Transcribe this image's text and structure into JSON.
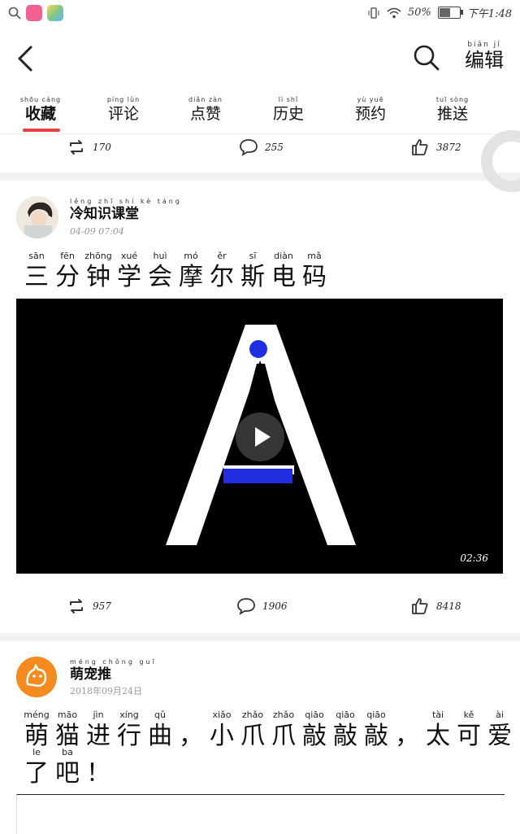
{
  "status_bar": {
    "battery": "50%",
    "time": "下午1:48",
    "icons": [
      "search-icon",
      "app-icon-pink",
      "app-icon-colorful",
      "vibrate-icon",
      "wifi-icon",
      "battery-icon"
    ]
  },
  "header": {
    "edit": {
      "pinyin": "biān jí",
      "text": "编辑"
    }
  },
  "tabs": [
    {
      "pinyin": "shōu cáng",
      "text": "收藏",
      "active": true
    },
    {
      "pinyin": "píng lùn",
      "text": "评论",
      "active": false
    },
    {
      "pinyin": "diǎn zàn",
      "text": "点赞",
      "active": false
    },
    {
      "pinyin": "lì shǐ",
      "text": "历史",
      "active": false
    },
    {
      "pinyin": "yù yuē",
      "text": "预约",
      "active": false
    },
    {
      "pinyin": "tuī sòng",
      "text": "推送",
      "active": false
    }
  ],
  "post_top_actions": {
    "repost": "170",
    "comment": "255",
    "like": "3872"
  },
  "post1": {
    "author_pinyin": "lěng zhī shí kè táng",
    "author": "冷知识课堂",
    "time": "04-09 07:04",
    "title": [
      {
        "py": "sān",
        "hz": "三"
      },
      {
        "py": "fēn",
        "hz": "分"
      },
      {
        "py": "zhōng",
        "hz": "钟"
      },
      {
        "py": "xué",
        "hz": "学"
      },
      {
        "py": "huì",
        "hz": "会"
      },
      {
        "py": "mó",
        "hz": "摩"
      },
      {
        "py": "ěr",
        "hz": "尔"
      },
      {
        "py": "sī",
        "hz": "斯"
      },
      {
        "py": "diàn",
        "hz": "电"
      },
      {
        "py": "mǎ",
        "hz": "码"
      }
    ],
    "video_duration": "02:36",
    "actions": {
      "repost": "957",
      "comment": "1906",
      "like": "8418"
    }
  },
  "post2": {
    "author_pinyin": "méng chǒng guī",
    "author": "萌宠推",
    "time": "2018年09月24日",
    "title_line1": [
      {
        "py": "méng",
        "hz": "萌"
      },
      {
        "py": "māo",
        "hz": "猫"
      },
      {
        "py": "jìn",
        "hz": "进"
      },
      {
        "py": "xíng",
        "hz": "行"
      },
      {
        "py": "qǔ",
        "hz": "曲"
      },
      {
        "py": "",
        "hz": "，"
      },
      {
        "py": "xiǎo",
        "hz": "小"
      },
      {
        "py": "zhǎo",
        "hz": "爪"
      },
      {
        "py": "zhǎo",
        "hz": "爪"
      },
      {
        "py": "qiāo",
        "hz": "敲"
      },
      {
        "py": "qiāo",
        "hz": "敲"
      },
      {
        "py": "qiāo",
        "hz": "敲"
      },
      {
        "py": "",
        "hz": "，"
      },
      {
        "py": "tài",
        "hz": "太"
      },
      {
        "py": "kě",
        "hz": "可"
      },
      {
        "py": "ài",
        "hz": "爱"
      }
    ],
    "title_line2": [
      {
        "py": "le",
        "hz": "了"
      },
      {
        "py": "ba",
        "hz": "吧"
      },
      {
        "py": "",
        "hz": "！"
      }
    ]
  }
}
